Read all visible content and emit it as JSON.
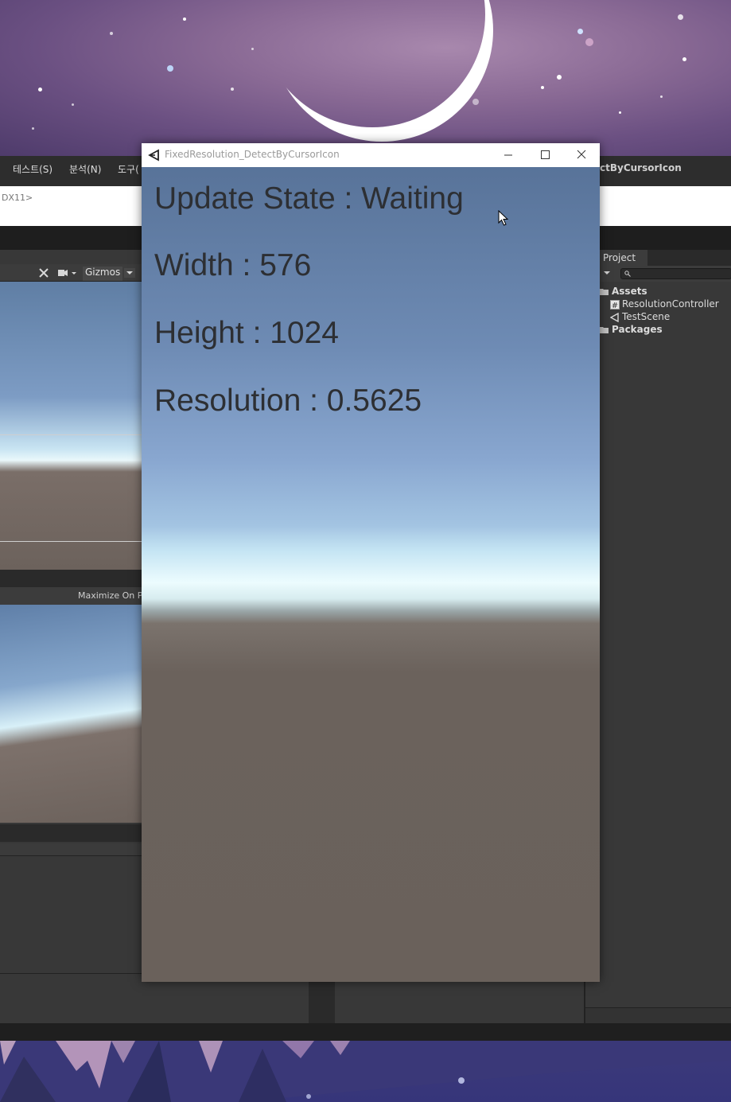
{
  "window": {
    "title": "FixedResolution_DetectByCursorIcon",
    "minimize_icon": "minimize-icon",
    "maximize_icon": "maximize-icon",
    "close_icon": "close-icon"
  },
  "game": {
    "update_state": "Update State : Waiting",
    "width": "Width : 576",
    "height": "Height : 1024",
    "resolution": "Resolution : 0.5625"
  },
  "editor": {
    "menu": [
      "테스트(S)",
      "분석(N)",
      "도구("
    ],
    "title_tail": "ctByCursorIcon",
    "graphics_api": "DX11>",
    "scene_toolbar": {
      "gizmos_label": "Gizmos"
    },
    "game_toolbar": {
      "maximize_label": "Maximize On P"
    },
    "project": {
      "tab_label": "Project",
      "tree": [
        {
          "label": "Assets",
          "icon": "folder-open-icon"
        },
        {
          "label": "ResolutionController",
          "icon": "script-icon"
        },
        {
          "label": "TestScene",
          "icon": "unity-scene-icon"
        },
        {
          "label": "Packages",
          "icon": "folder-icon"
        }
      ]
    }
  },
  "colors": {
    "sky_top": "#587399",
    "horizon": "#ecfcfe",
    "ground": "#6a615b",
    "text": "#2d2f33"
  }
}
